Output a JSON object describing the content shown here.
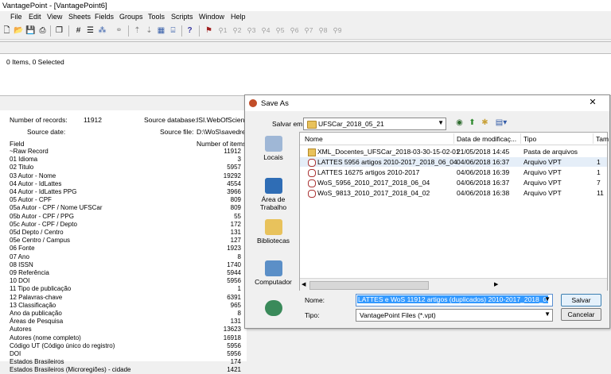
{
  "app": {
    "title": "VantagePoint - [VantagePoint6]"
  },
  "menu": [
    "File",
    "Edit",
    "View",
    "Sheets",
    "Fields",
    "Groups",
    "Tools",
    "Scripts",
    "Window",
    "Help"
  ],
  "toolbar": {
    "dim_labels": [
      "1",
      "2",
      "3",
      "4",
      "5",
      "6",
      "7",
      "8",
      "9"
    ]
  },
  "list_panel": {
    "status": "0 Items, 0 Selected"
  },
  "info": {
    "records_label": "Number of records:",
    "records_value": "11912",
    "source_db_label": "Source database:",
    "source_db_value": "ISI.WebOfScience",
    "source_date_label": "Source date:",
    "source_file_label": "Source file:",
    "source_file_value": "D:\\WoS\\savedrecs",
    "field_header": "Field",
    "items_header": "Number of items",
    "fields": [
      {
        "name": "~Raw Record",
        "count": "11912"
      },
      {
        "name": "01 Idioma",
        "count": "3"
      },
      {
        "name": "02 Titulo",
        "count": "5957"
      },
      {
        "name": "03 Autor - Nome",
        "count": "19292"
      },
      {
        "name": "04 Autor - IdLattes",
        "count": "4554"
      },
      {
        "name": "04 Autor - IdLattes PPG",
        "count": "3966"
      },
      {
        "name": "05 Autor - CPF",
        "count": "809"
      },
      {
        "name": "05a Autor - CPF / Nome UFSCar",
        "count": "809"
      },
      {
        "name": "05b Autor - CPF / PPG",
        "count": "55"
      },
      {
        "name": "05c Autor - CPF / Depto",
        "count": "172"
      },
      {
        "name": "05d Depto / Centro",
        "count": "131"
      },
      {
        "name": "05e Centro / Campus",
        "count": "127"
      },
      {
        "name": "06 Fonte",
        "count": "1923"
      },
      {
        "name": "07 Ano",
        "count": "8"
      },
      {
        "name": "08 ISSN",
        "count": "1740"
      },
      {
        "name": "09 Referência",
        "count": "5944"
      },
      {
        "name": "10 DOI",
        "count": "5956"
      },
      {
        "name": "11 Tipo de publicação",
        "count": "1"
      },
      {
        "name": "12 Palavras-chave",
        "count": "6391"
      },
      {
        "name": "13 Classificação",
        "count": "965"
      },
      {
        "name": "Ano da publicação",
        "count": "8"
      },
      {
        "name": "Áreas de Pesquisa",
        "count": "131"
      },
      {
        "name": "Autores",
        "count": "13623"
      },
      {
        "name": "Autores (nome completo)",
        "count": "16918"
      },
      {
        "name": "Código UT (Código único do registro)",
        "count": "5956"
      },
      {
        "name": "DOI",
        "count": "5956"
      },
      {
        "name": "Estados Brasileiros",
        "count": "174"
      },
      {
        "name": "Estados Brasileiros (Microregiões) - cidade",
        "count": "1421"
      }
    ]
  },
  "dialog": {
    "title": "Save As",
    "close": "✕",
    "save_in_label": "Salvar em:",
    "save_in_value": "UFSCar_2018_05_21",
    "places": [
      "Locais",
      "Área de Trabalho",
      "Bibliotecas",
      "Computador"
    ],
    "columns": {
      "name": "Nome",
      "date": "Data de modificaç...",
      "type": "Tipo",
      "size": "Tam"
    },
    "files": [
      {
        "name": "XML_Docentes_UFSCar_2018-03-30-15-02-01",
        "date": "21/05/2018 14:45",
        "type": "Pasta de arquivos",
        "size": "",
        "kind": "folder"
      },
      {
        "name": "LATTES 5956 artigos 2010-2017_2018_06_04",
        "date": "04/06/2018 16:37",
        "type": "Arquivo VPT",
        "size": "1",
        "kind": "vpt"
      },
      {
        "name": "LATTES 16275 artigos 2010-2017",
        "date": "04/06/2018 16:39",
        "type": "Arquivo VPT",
        "size": "1",
        "kind": "vpt"
      },
      {
        "name": "WoS_5956_2010_2017_2018_06_04",
        "date": "04/06/2018 16:37",
        "type": "Arquivo VPT",
        "size": "7",
        "kind": "vpt"
      },
      {
        "name": "WoS_9813_2010_2017_2018_04_02",
        "date": "04/06/2018 16:38",
        "type": "Arquivo VPT",
        "size": "11",
        "kind": "vpt"
      }
    ],
    "filename_label": "Nome:",
    "filename_value": "LATTES e WoS 11912 artigos (duplicados) 2010-2017_2018_06_04",
    "type_label": "Tipo:",
    "type_value": "VantagePoint Files (*.vpt)",
    "save_button": "Salvar",
    "cancel_button": "Cancelar"
  }
}
